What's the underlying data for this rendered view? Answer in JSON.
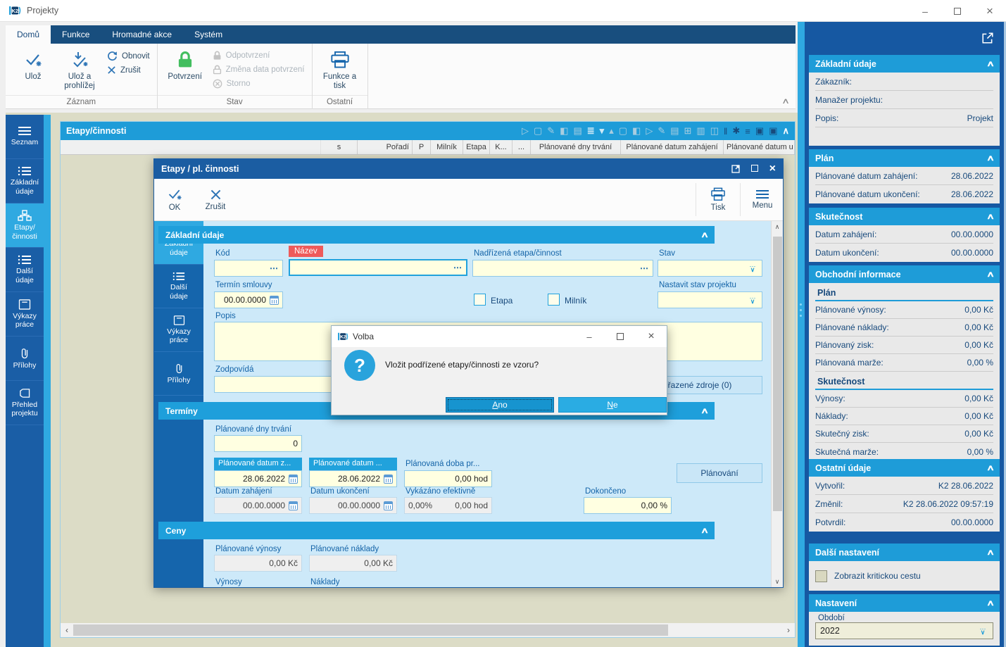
{
  "glyphs": {
    "ellipsis": "⋯",
    "collapse": "∧",
    "scroll_up": "∧",
    "scroll_down": "∨",
    "scroll_left": "‹",
    "scroll_right": "›",
    "minimize": "–",
    "close": "×",
    "question": "?",
    "dots": "⋯",
    "chevron_down": "∨"
  },
  "colors": {
    "accent_cyan": "#1E9CD8",
    "active_tab": "#2FA9E1",
    "navy": "#17497C",
    "sidebar_blue": "#1A5EA6",
    "tabstrip_navy": "#184E7E",
    "field_yellow": "#FFFFE1",
    "required_red": "#EE5A5A",
    "confirm_green": "#43BE5F",
    "desktop_beige": "#DCDCC6",
    "dialog_button_blue": "#2AACE3"
  },
  "titlebar": {
    "title": "Projekty"
  },
  "ribbon": {
    "tabs": [
      {
        "label": "Domů"
      },
      {
        "label": "Funkce"
      },
      {
        "label": "Hromadné akce"
      },
      {
        "label": "Systém"
      }
    ],
    "save": "Ulož",
    "save_and_view": "Ulož a\nprohlížej",
    "refresh": "Obnovit",
    "cancel": "Zrušit",
    "confirm": "Potvrzení",
    "unconfirm": "Odpotvrzení",
    "change_confirm_date": "Změna data potvrzení",
    "storno": "Storno",
    "functions_print": "Funkce a\ntisk",
    "group_record": "Záznam",
    "group_state": "Stav",
    "group_other": "Ostatní"
  },
  "sidebar": {
    "items": [
      {
        "label": "Seznam"
      },
      {
        "label": "Základní\núdaje"
      },
      {
        "label": "Etapy/\nčinnosti"
      },
      {
        "label": "Další\núdaje"
      },
      {
        "label": "Výkazy\npráce"
      },
      {
        "label": "Přílohy"
      },
      {
        "label": "Přehled\nprojektu"
      }
    ]
  },
  "panel": {
    "title": "Etapy/činnosti",
    "toolbar_icons": [
      "▷",
      "▢",
      "✎",
      "◧",
      "▤",
      "≣",
      "▾",
      "▴",
      "▢",
      "◧",
      "▷",
      "✎",
      "▤",
      "⊞",
      "▥",
      "◫",
      "‖",
      "✱",
      "≡",
      "▣",
      "▣"
    ],
    "columns": [
      "s",
      "Pořadí",
      "P",
      "Milník",
      "Etapa",
      "K...",
      "...",
      "Plánované dny trvání",
      "Plánované datum zahájení",
      "Plánované datum u"
    ]
  },
  "editor": {
    "title": "Etapy / pl. činnosti",
    "ok": "OK",
    "cancel": "Zrušit",
    "print": "Tisk",
    "menu": "Menu",
    "tabs": [
      {
        "label": "Základní\núdaje"
      },
      {
        "label": "Další\núdaje"
      },
      {
        "label": "Výkazy\npráce"
      },
      {
        "label": "Přílohy"
      }
    ],
    "basic": {
      "title": "Základní údaje",
      "kod": "Kód",
      "nazev": "Název",
      "nadrizena": "Nadřízená etapa/činnost",
      "stav": "Stav",
      "termin": "Termín smlouvy",
      "termin_value": "00.00.0000",
      "etapa": "Etapa",
      "milnik": "Milník",
      "nastavit": "Nastavit stav projektu",
      "popis": "Popis",
      "zodpovida": "Zodpovídá",
      "zdroje": "Přiřazené zdroje (0)"
    },
    "terminy": {
      "title": "Termíny",
      "dny": "Plánované dny trvání",
      "dny_value": "0",
      "pdz": "Plánované datum z...",
      "pdz_value": "28.06.2022",
      "pdu": "Plánované datum ...",
      "pdu_value": "28.06.2022",
      "doba": "Plánovaná doba pr...",
      "doba_value": "0,00 hod",
      "planovani": "Plánování",
      "dz": "Datum zahájení",
      "dz_value": "00.00.0000",
      "du": "Datum ukončení",
      "du_value": "00.00.0000",
      "vykazano": "Vykázáno efektivně",
      "vykazano_pct": "0,00%",
      "vykazano_hod": "0,00 hod",
      "dokonceno": "Dokončeno",
      "dokonceno_value": "0,00 %"
    },
    "ceny": {
      "title": "Ceny",
      "pv": "Plánované výnosy",
      "pv_value": "0,00 Kč",
      "pn": "Plánované náklady",
      "pn_value": "0,00 Kč",
      "vynosy": "Výnosy",
      "naklady": "Náklady"
    }
  },
  "dialog": {
    "title": "Volba",
    "message": "Vložit podřízené etapy/činnosti ze vzoru?",
    "yes": "Ano",
    "no": "Ne"
  },
  "right": {
    "panels": [
      {
        "title": "Základní údaje",
        "rows": [
          {
            "label": "Zákazník:",
            "value": ""
          },
          {
            "label": "Manažer projektu:",
            "value": ""
          },
          {
            "label": "Popis:",
            "value": "Projekt"
          }
        ]
      },
      {
        "title": "Plán",
        "rows": [
          {
            "label": "Plánované datum zahájení:",
            "value": "28.06.2022"
          },
          {
            "label": "Plánované datum ukončení:",
            "value": "28.06.2022"
          }
        ]
      },
      {
        "title": "Skutečnost",
        "rows": [
          {
            "label": "Datum zahájení:",
            "value": "00.00.0000"
          },
          {
            "label": "Datum ukončení:",
            "value": "00.00.0000"
          }
        ]
      },
      {
        "title": "Obchodní informace",
        "subtitle_plan": "Plán",
        "plan_rows": [
          {
            "label": "Plánované výnosy:",
            "value": "0,00 Kč"
          },
          {
            "label": "Plánované náklady:",
            "value": "0,00 Kč"
          },
          {
            "label": "Plánovaný zisk:",
            "value": "0,00 Kč"
          },
          {
            "label": "Plánovaná marže:",
            "value": "0,00 %"
          }
        ],
        "subtitle_fact": "Skutečnost",
        "fact_rows": [
          {
            "label": "Výnosy:",
            "value": "0,00 Kč"
          },
          {
            "label": "Náklady:",
            "value": "0,00 Kč"
          },
          {
            "label": "Skutečný zisk:",
            "value": "0,00 Kč"
          },
          {
            "label": "Skutečná marže:",
            "value": "0,00 %"
          }
        ]
      },
      {
        "title": "Ostatní údaje",
        "rows": [
          {
            "label": "Vytvořil:",
            "value": "K2 28.06.2022"
          },
          {
            "label": "Změnil:",
            "value": "K2 28.06.2022 09:57:19"
          },
          {
            "label": "Potvrdil:",
            "value": "00.00.0000"
          }
        ]
      },
      {
        "title": "Další nastavení",
        "checkbox_label": "Zobrazit kritickou cestu"
      },
      {
        "title": "Nastavení",
        "obdobi_label": "Období",
        "obdobi_value": "2022"
      }
    ]
  }
}
